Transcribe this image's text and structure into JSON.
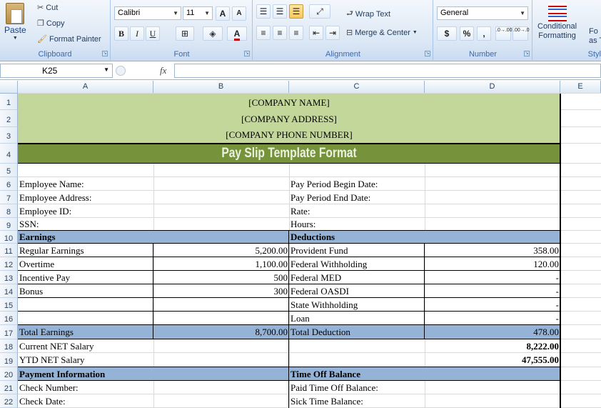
{
  "ribbon": {
    "clipboard": {
      "paste": "Paste",
      "cut": "Cut",
      "copy": "Copy",
      "format_painter": "Format Painter",
      "label": "Clipboard"
    },
    "font": {
      "name": "Calibri",
      "size": "11",
      "bold": "B",
      "italic": "I",
      "underline": "U",
      "grow": "A",
      "shrink": "A",
      "color": "A",
      "label": "Font"
    },
    "alignment": {
      "wrap_text": "Wrap Text",
      "merge_center": "Merge & Center",
      "label": "Alignment"
    },
    "number": {
      "format": "General",
      "currency": "$",
      "percent": "%",
      "comma": ",",
      "inc_decimal": ".0→.00",
      "dec_decimal": ".00→.0",
      "label": "Number"
    },
    "styles": {
      "conditional_formatting_1": "Conditional",
      "conditional_formatting_2": "Formatting",
      "format_as_table_1": "Fo",
      "format_as_table_2": "as T",
      "label": "Styl"
    }
  },
  "formula_bar": {
    "name_box": "K25",
    "fx": "fx",
    "content": ""
  },
  "columns": [
    "A",
    "B",
    "C",
    "D",
    "E"
  ],
  "rows": [
    "1",
    "2",
    "3",
    "4",
    "5",
    "6",
    "7",
    "8",
    "9",
    "10",
    "11",
    "12",
    "13",
    "14",
    "15",
    "16",
    "17",
    "18",
    "19",
    "20",
    "21",
    "22"
  ],
  "colors": {
    "header_green": "#c4d79b",
    "title_green": "#76933c",
    "section_blue": "#95b3d7",
    "title_text": "#ebf1de"
  },
  "sheet": {
    "company_name": "[COMPANY NAME]",
    "company_address": "[COMPANY ADDRESS]",
    "company_phone": "[COMPANY PHONE NUMBER]",
    "title": "Pay Slip Template Format",
    "employee_name": "Employee Name:",
    "employee_address": "Employee Address:",
    "employee_id": "Employee ID:",
    "ssn": "SSN:",
    "pay_period_begin": "Pay Period Begin Date:",
    "pay_period_end": "Pay Period End Date:",
    "rate": "Rate:",
    "hours": "Hours:",
    "earnings_header": "Earnings",
    "deductions_header": "Deductions",
    "earnings": [
      {
        "label": "Regular Earnings",
        "value": "5,200.00"
      },
      {
        "label": "Overtime",
        "value": "1,100.00"
      },
      {
        "label": "Incentive Pay",
        "value": "500"
      },
      {
        "label": "Bonus",
        "value": "300"
      },
      {
        "label": "",
        "value": ""
      },
      {
        "label": "",
        "value": ""
      }
    ],
    "deductions": [
      {
        "label": "Provident Fund",
        "value": "358.00"
      },
      {
        "label": "Federal Withholding",
        "value": "120.00"
      },
      {
        "label": "Federal MED",
        "value": "-"
      },
      {
        "label": "Federal OASDI",
        "value": "-"
      },
      {
        "label": "State Withholding",
        "value": "-"
      },
      {
        "label": "Loan",
        "value": "-"
      }
    ],
    "total_earnings_label": "Total Earnings",
    "total_earnings_value": "8,700.00",
    "total_deduction_label": "Total Deduction",
    "total_deduction_value": "478.00",
    "current_net_label": "Current NET Salary",
    "current_net_value": "8,222.00",
    "ytd_net_label": "YTD NET Salary",
    "ytd_net_value": "47,555.00",
    "payment_info_header": "Payment Information",
    "time_off_header": "Time Off Balance",
    "check_number": "Check  Number:",
    "check_date": "Check Date:",
    "paid_time_off": "Paid Time Off Balance:",
    "sick_time": "Sick Time Balance:"
  }
}
